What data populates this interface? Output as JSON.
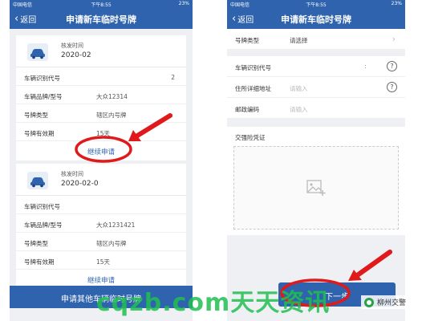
{
  "left_phone": {
    "status": {
      "carrier": "中国电信",
      "time": "下午8:55",
      "battery": "23%"
    },
    "nav": {
      "back": "返回",
      "title": "申请新车临时号牌"
    },
    "cards": [
      {
        "approve_label": "核发时间",
        "approve_date": "2020-02",
        "rows": [
          {
            "key": "车辆识别代号",
            "value": "",
            "right": "2"
          },
          {
            "key": "车辆品牌/型号",
            "value": "大众12314",
            "right": ""
          },
          {
            "key": "号牌类型",
            "value": "辖区内号牌",
            "right": ""
          },
          {
            "key": "号牌有效期",
            "value": "15天",
            "right": ""
          }
        ],
        "action": "继续申请"
      },
      {
        "approve_label": "核发时间",
        "approve_date": "2020-02-0",
        "rows": [
          {
            "key": "车辆识别代号",
            "value": "",
            "right": ""
          },
          {
            "key": "车辆品牌/型号",
            "value": "大众1231421",
            "right": ""
          },
          {
            "key": "号牌类型",
            "value": "辖区内号牌",
            "right": ""
          },
          {
            "key": "号牌有效期",
            "value": "15天",
            "right": ""
          }
        ],
        "action": "继续申请"
      }
    ],
    "bottom_button": "申请其他车辆临时号牌"
  },
  "right_phone": {
    "status": {
      "carrier": "中国电信",
      "time": "下午8:55",
      "battery": "23%"
    },
    "nav": {
      "back": "返回",
      "title": "申请新车临时号牌"
    },
    "fields": {
      "plate_type": {
        "label": "号牌类型",
        "value": "请选择"
      },
      "vin": {
        "label": "车辆识别代号",
        "colon": ":"
      },
      "address": {
        "label": "住所详细地址",
        "placeholder": "请输入"
      },
      "postal": {
        "label": "邮政编码",
        "placeholder": "请输入"
      }
    },
    "insurance_label": "交强险凭证",
    "next_button": "下一步"
  },
  "overlay": {
    "watermark": "cqzb.com天天资讯",
    "brand": "柳州交警",
    "arrow_color": "#e0191b"
  }
}
